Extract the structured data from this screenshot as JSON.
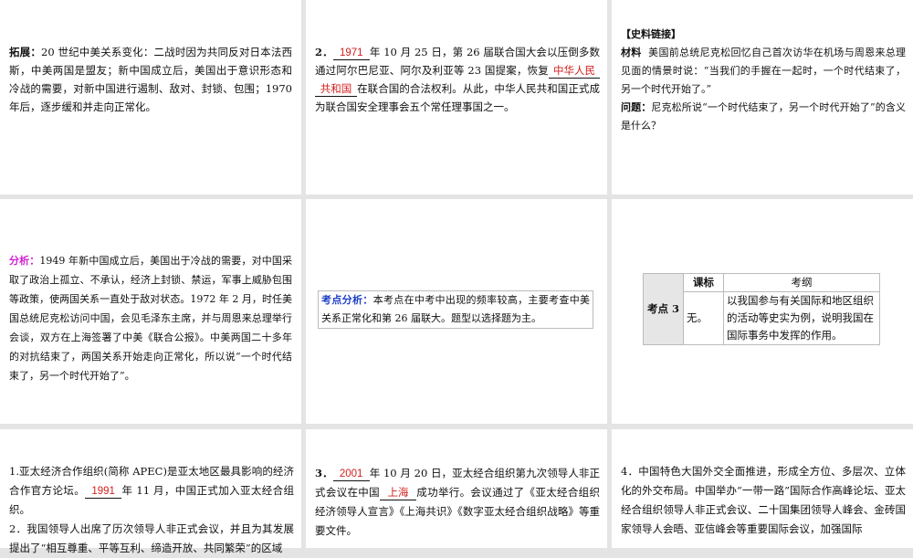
{
  "p1": {
    "label": "拓展：",
    "text": "20 世纪中美关系变化：二战时因为共同反对日本法西斯，中美两国是盟友；新中国成立后，美国出于意识形态和冷战的需要，对新中国进行遏制、敌对、封锁、包围；1970年后，逐步缓和并走向正常化。"
  },
  "p2": {
    "num": "2．",
    "a1": "1971",
    "t1": "年 10 月 25 日，第 26 届联合国大会以压倒多数通过阿尔巴尼亚、阿尔及利亚等 23 国提案，恢复",
    "a2": "中华人民",
    "a3": "共和国",
    "t2": "在联合国的合法权利。从此，中华人民共和国正式成为联合国安全理事会五个常任理事国之一。"
  },
  "p3": {
    "heading": "【史料链接】",
    "label1": "材料",
    "material": "美国前总统尼克松回忆自己首次访华在机场与周恩来总理见面的情景时说：“当我们的手握在一起时，一个时代结束了，另一个时代开始了。”",
    "label2": "问题：",
    "question": "尼克松所说“一个时代结束了，另一个时代开始了”的含义是什么？"
  },
  "p4": {
    "label": "分析：",
    "text": "1949 年新中国成立后，美国出于冷战的需要，对中国采取了政治上孤立、不承认，经济上封锁、禁运，军事上威胁包围等政策，使两国关系一直处于敌对状态。1972 年 2 月，时任美国总统尼克松访问中国，会见毛泽东主席，并与周恩来总理举行会谈，双方在上海签署了中美《联合公报》。中美两国二十多年的对抗结束了，两国关系开始走向正常化，所以说“一个时代结束了，另一个时代开始了”。"
  },
  "p5": {
    "label": "考点分析：",
    "text": "本考点在中考中出现的频率较高，主要考查中美关系正常化和第 26 届联大。题型以选择题为主。"
  },
  "p6": {
    "row_header": "考点 3",
    "col1": "课标",
    "col2": "考纲",
    "cell1": "无。",
    "cell2": "以我国参与有关国际和地区组织的活动等史实为例，说明我国在国际事务中发挥的作用。"
  },
  "p7": {
    "t1": "1.亚太经济合作组织(简称 APEC)是亚太地区最具影响的经济合作官方论坛。",
    "a1": "1991",
    "t2": "年 11 月，中国正式加入亚太经合组织。",
    "t3": "2．我国领导人出席了历次领导人非正式会议，并且为其发展提出了“相互尊重、平等互利、缔造开放、共同繁荣”的区域"
  },
  "p8": {
    "num": "3．",
    "a1": "2001",
    "t1": "年 10 月 20 日，亚太经合组织第九次领导人非正式会议在中国",
    "a2": "上海",
    "t2": "成功举行。会议通过了《亚太经合组织经济领导人宣言》《上海共识》《数字亚太经合组织战略》等重要文件。"
  },
  "p9": {
    "text": "4．中国特色大国外交全面推进，形成全方位、多层次、立体化的外交布局。中国举办“一带一路”国际合作高峰论坛、亚太经合组织领导人非正式会议、二十国集团领导人峰会、金砖国家领导人会晤、亚信峰会等重要国际会议，加强国际"
  }
}
